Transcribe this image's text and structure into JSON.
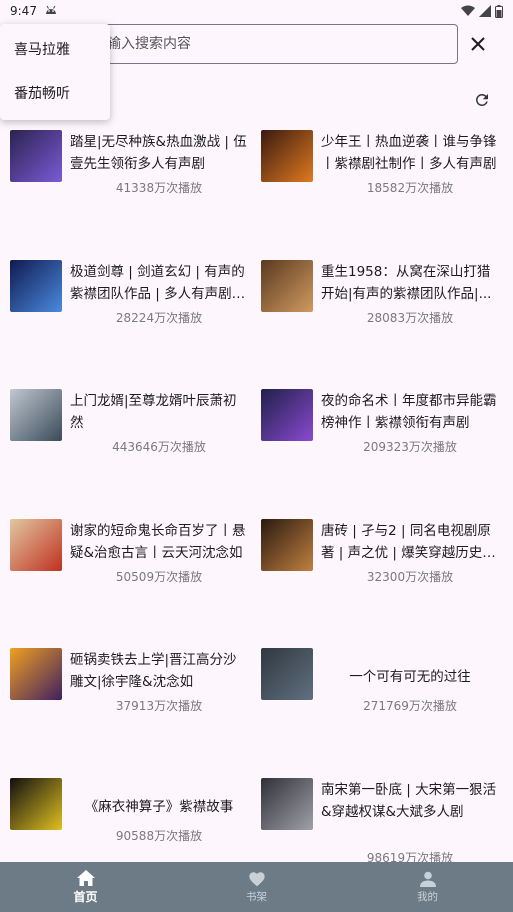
{
  "status": {
    "time": "9:47"
  },
  "search": {
    "placeholder": "输入搜索内容"
  },
  "dropdown": {
    "items": [
      "喜马拉雅",
      "番茄畅听"
    ]
  },
  "cards": [
    {
      "title": "踏星|无尽种族&热血激战 | 伍壹先生领衔多人有声剧",
      "plays": "41338万次播放",
      "colors": [
        "#2a2350",
        "#7b5bd6"
      ]
    },
    {
      "title": "少年王丨热血逆袭丨谁与争锋丨紫襟剧社制作丨多人有声剧",
      "plays": "18582万次播放",
      "colors": [
        "#3a1a10",
        "#e07a20"
      ]
    },
    {
      "title": "极道剑尊 | 剑道玄幻 | 有声的紫襟团队作品 | 多人有声剧 |...",
      "plays": "28224万次播放",
      "colors": [
        "#101a50",
        "#4a8adf"
      ]
    },
    {
      "title": "重生1958：从窝在深山打猎开始|有声的紫襟团队作品|...",
      "plays": "28083万次播放",
      "colors": [
        "#5a3a20",
        "#d09a60"
      ]
    },
    {
      "title": "上门龙婿|至尊龙婿叶辰萧初然",
      "plays": "443646万次播放",
      "colors": [
        "#c0c8d0",
        "#3a4a5a"
      ]
    },
    {
      "title": "夜的命名术丨年度都市异能霸榜神作丨紫襟领衔有声剧",
      "plays": "209323万次播放",
      "colors": [
        "#20204a",
        "#8a4ad0"
      ]
    },
    {
      "title": "谢家的短命鬼长命百岁了丨悬疑&治愈古言丨云天河沈念如",
      "plays": "50509万次播放",
      "colors": [
        "#e0c8a0",
        "#c03020"
      ]
    },
    {
      "title": "唐砖 | 孑与2 | 同名电视剧原著 | 声之优 | 爆笑穿越历史 | ...",
      "plays": "32300万次播放",
      "colors": [
        "#2a1a10",
        "#c08040"
      ]
    },
    {
      "title": "砸锅卖铁去上学|晋江高分沙雕文|徐宇隆&沈念如",
      "plays": "37913万次播放",
      "colors": [
        "#f0a020",
        "#402060"
      ]
    },
    {
      "title": "一个可有可无的过往",
      "plays": "271769万次播放",
      "colors": [
        "#303840",
        "#607080"
      ]
    },
    {
      "title": "《麻衣神算子》紫襟故事",
      "plays": "90588万次播放",
      "colors": [
        "#101010",
        "#e0c020"
      ]
    },
    {
      "title": "南宋第一卧底 | 大宋第一狠活&穿越权谋&大斌多人剧",
      "plays": "98619万次播放",
      "colors": [
        "#303038",
        "#a0a0a8"
      ]
    }
  ],
  "nav": {
    "home": "首页",
    "shelf": "书架",
    "mine": "我的"
  },
  "colors": {
    "nav_bg": "#6d7b86",
    "page_bg": "#fdf7fd"
  }
}
